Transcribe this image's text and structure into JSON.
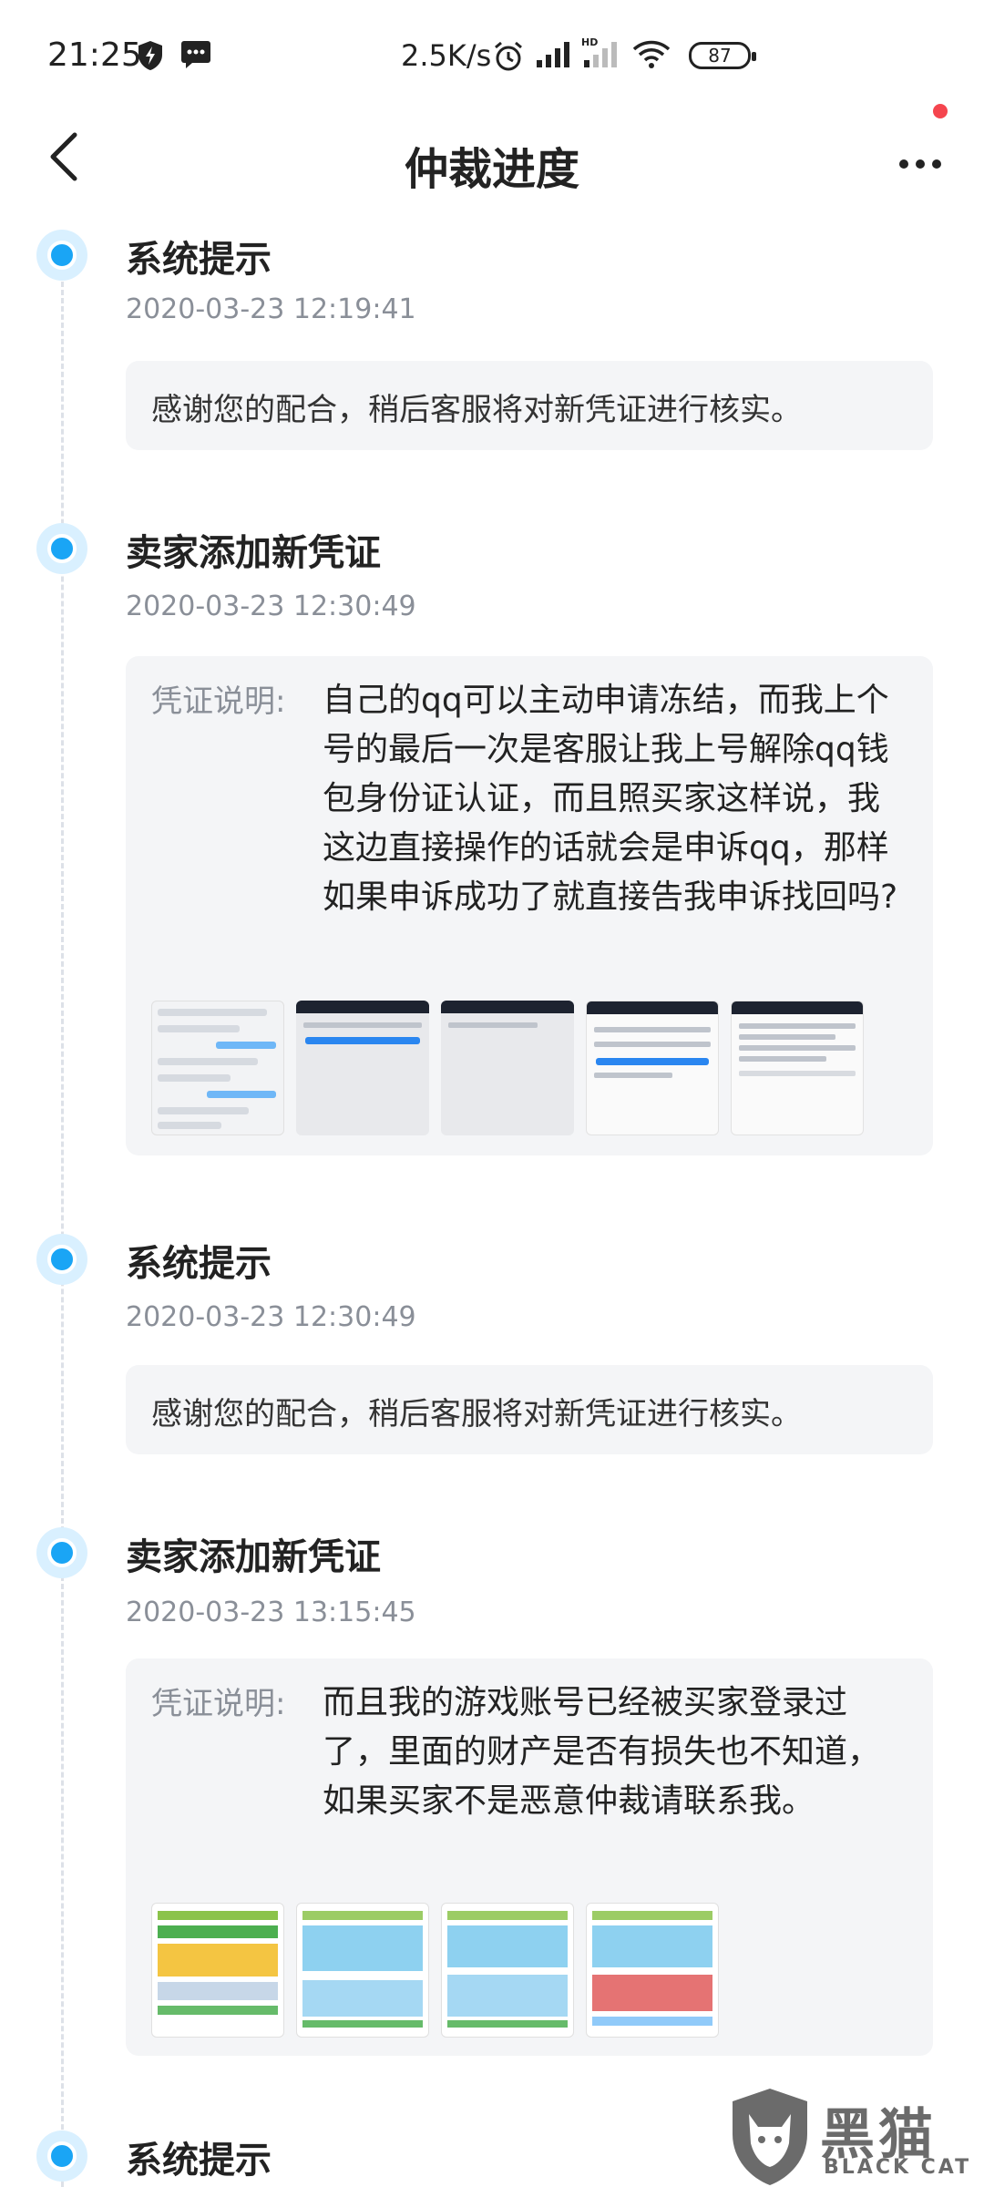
{
  "status_bar": {
    "time": "21:25",
    "net_speed": "2.5K/s",
    "battery": "87"
  },
  "nav": {
    "title": "仲裁进度",
    "has_notification_dot": true,
    "accent_color": "#1aa5f5",
    "notification_color": "#f5454e"
  },
  "events": [
    {
      "title": "系统提示",
      "time": "2020-03-23 12:19:41",
      "message": "感谢您的配合，稍后客服将对新凭证进行核实。"
    },
    {
      "title": "卖家添加新凭证",
      "time": "2020-03-23 12:30:49",
      "label": "凭证说明:",
      "description": "自己的qq可以主动申请冻结，而我上个号的最后一次是客服让我上号解除qq钱包身份证认证，而且照买家这样说，我这边直接操作的话就会是申诉qq，那样如果申诉成功了就直接告我申诉找回吗?"
    },
    {
      "title": "系统提示",
      "time": "2020-03-23 12:30:49",
      "message": "感谢您的配合，稍后客服将对新凭证进行核实。"
    },
    {
      "title": "卖家添加新凭证",
      "time": "2020-03-23 13:15:45",
      "label": "凭证说明:",
      "description": "而且我的游戏账号已经被买家登录过了，里面的财产是否有损失也不知道，如果买家不是恶意仲裁请联系我。"
    },
    {
      "title": "系统提示"
    }
  ],
  "watermark": {
    "cn": "黑猫",
    "en": "BLACK CAT"
  }
}
